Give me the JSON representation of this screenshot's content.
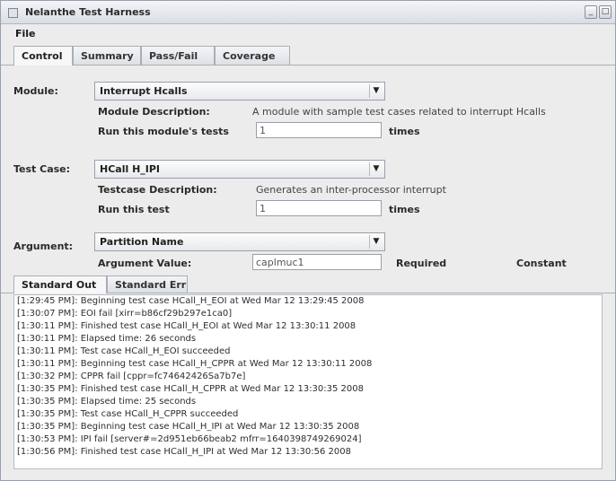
{
  "window": {
    "title": "Nelanthe Test Harness"
  },
  "menu": {
    "file": "File"
  },
  "tabs": {
    "main": [
      "Control",
      "Summary",
      "Pass/Fail",
      "Coverage"
    ],
    "output": [
      "Standard Out",
      "Standard Err"
    ]
  },
  "module": {
    "label": "Module:",
    "selected": "Interrupt Hcalls",
    "description_label": "Module Description:",
    "description": "A module with sample test cases related to interrupt Hcalls",
    "run_label": "Run this module's tests",
    "run_value": "1",
    "times": "times"
  },
  "testcase": {
    "label": "Test Case:",
    "selected": "HCall H_IPI",
    "description_label": "Testcase Description:",
    "description": "Generates an inter-processor interrupt",
    "run_label": "Run this test",
    "run_value": "1",
    "times": "times"
  },
  "argument": {
    "label": "Argument:",
    "selected": "Partition Name",
    "value_label": "Argument Value:",
    "value": "caplmuc1",
    "required": "Required",
    "constant": "Constant"
  },
  "icons": {
    "combo_arrow": "▼",
    "minimize": "_",
    "maximize": "□"
  },
  "console_lines": [
    "[1:29:45 PM]: Beginning test case HCall_H_EOI at Wed Mar 12 13:29:45 2008",
    "[1:30:07 PM]: EOI fail [xirr=b86cf29b297e1ca0]",
    "[1:30:11 PM]: Finished test case HCall_H_EOI at Wed Mar 12 13:30:11 2008",
    "[1:30:11 PM]: Elapsed time: 26 seconds",
    "[1:30:11 PM]: Test case HCall_H_EOI succeeded",
    "[1:30:11 PM]: Beginning test case HCall_H_CPPR at Wed Mar 12 13:30:11 2008",
    "[1:30:32 PM]: CPPR fail [cppr=fc74642426Sa7b7e]",
    "[1:30:35 PM]: Finished test case HCall_H_CPPR at Wed Mar 12 13:30:35 2008",
    "[1:30:35 PM]: Elapsed time: 25 seconds",
    "[1:30:35 PM]: Test case HCall_H_CPPR succeeded",
    "[1:30:35 PM]: Beginning test case HCall_H_IPI at Wed Mar 12 13:30:35 2008",
    "[1:30:53 PM]: IPI fail [server#=2d951eb66beab2 mfrr=1640398749269024]",
    "[1:30:56 PM]: Finished test case HCall_H_IPI at Wed Mar 12 13:30:56 2008"
  ]
}
